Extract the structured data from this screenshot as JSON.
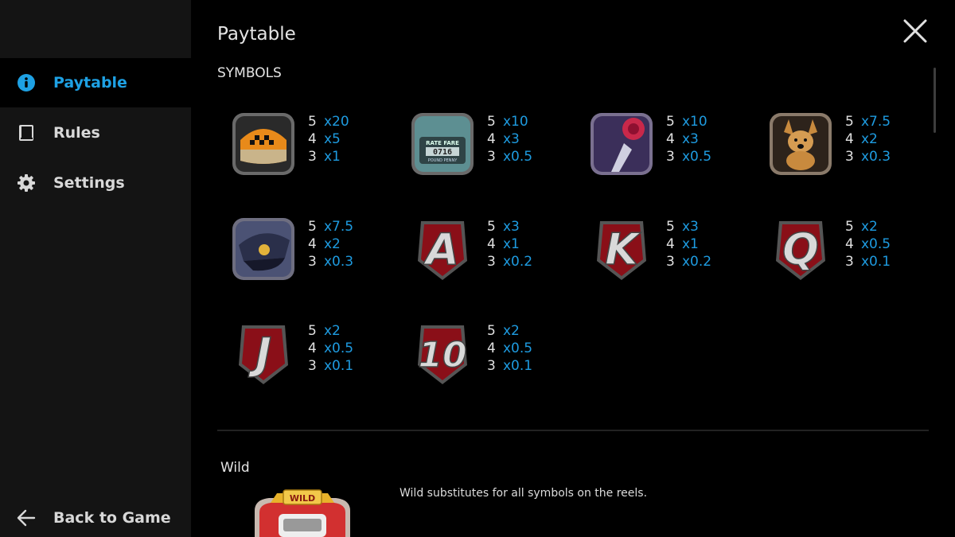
{
  "sidebar": {
    "items": [
      {
        "label": "Paytable",
        "icon": "info-icon",
        "active": true
      },
      {
        "label": "Rules",
        "icon": "book-icon",
        "active": false
      },
      {
        "label": "Settings",
        "icon": "gear-icon",
        "active": false
      }
    ],
    "back_label": "Back to Game"
  },
  "main": {
    "title": "Paytable",
    "section_title": "SYMBOLS",
    "symbols": [
      {
        "icon": "taxi-icon",
        "pays": [
          [
            "5",
            "x20"
          ],
          [
            "4",
            "x5"
          ],
          [
            "3",
            "x1"
          ]
        ]
      },
      {
        "icon": "taximeter-icon",
        "pays": [
          [
            "5",
            "x10"
          ],
          [
            "4",
            "x3"
          ],
          [
            "3",
            "x0.5"
          ]
        ]
      },
      {
        "icon": "rose-icon",
        "pays": [
          [
            "5",
            "x10"
          ],
          [
            "4",
            "x3"
          ],
          [
            "3",
            "x0.5"
          ]
        ]
      },
      {
        "icon": "dog-icon",
        "pays": [
          [
            "5",
            "x7.5"
          ],
          [
            "4",
            "x2"
          ],
          [
            "3",
            "x0.3"
          ]
        ]
      },
      {
        "icon": "cap-icon",
        "pays": [
          [
            "5",
            "x7.5"
          ],
          [
            "4",
            "x2"
          ],
          [
            "3",
            "x0.3"
          ]
        ]
      },
      {
        "icon": "letter-a-icon",
        "pays": [
          [
            "5",
            "x3"
          ],
          [
            "4",
            "x1"
          ],
          [
            "3",
            "x0.2"
          ]
        ]
      },
      {
        "icon": "letter-k-icon",
        "pays": [
          [
            "5",
            "x3"
          ],
          [
            "4",
            "x1"
          ],
          [
            "3",
            "x0.2"
          ]
        ]
      },
      {
        "icon": "letter-q-icon",
        "pays": [
          [
            "5",
            "x2"
          ],
          [
            "4",
            "x0.5"
          ],
          [
            "3",
            "x0.1"
          ]
        ]
      },
      {
        "icon": "letter-j-icon",
        "pays": [
          [
            "5",
            "x2"
          ],
          [
            "4",
            "x0.5"
          ],
          [
            "3",
            "x0.1"
          ]
        ]
      },
      {
        "icon": "number-10-icon",
        "pays": [
          [
            "5",
            "x2"
          ],
          [
            "4",
            "x0.5"
          ],
          [
            "3",
            "x0.1"
          ]
        ]
      }
    ],
    "wild_title": "Wild",
    "wild_badge": "WILD",
    "wild_description": "Wild substitutes for all symbols on the reels."
  },
  "symbol_texts": {
    "meter_label": "RATE FARE",
    "meter_digits": "0716",
    "meter_sub": "POUND PENNY",
    "letters": [
      "A",
      "K",
      "Q",
      "J",
      "10"
    ]
  },
  "colors": {
    "accent": "#1ea1e4",
    "multiplier": "#1e9be0",
    "sidebar_bg": "#141414",
    "background": "#000000"
  }
}
